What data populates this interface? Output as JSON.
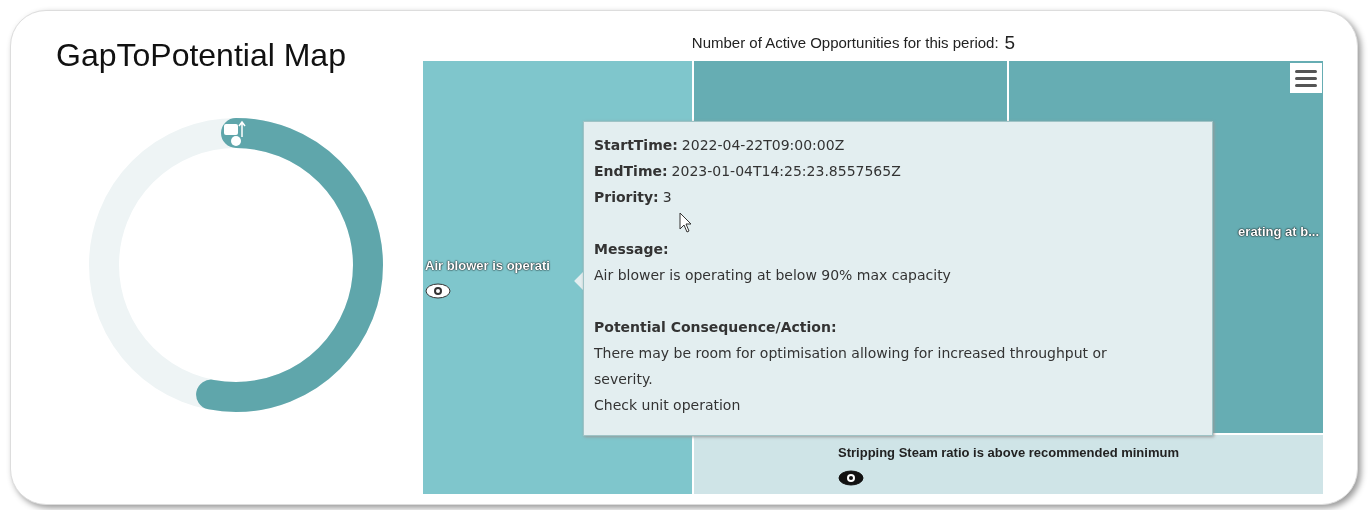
{
  "title": "GapToPotential Map",
  "gauge": {
    "level": 0.53
  },
  "opportunities": {
    "label": "Number of Active Opportunities for this period:",
    "count": "5"
  },
  "treemap": {
    "cells": [
      {
        "label": "Air blower is operati",
        "color": "#7fc6cc"
      },
      {
        "color": "#66adb3"
      },
      {
        "label": "erating at b...",
        "color": "#66adb3"
      },
      {
        "label": "Stripping Steam ratio is above recommended minimum",
        "color": "#cfe4e7"
      }
    ]
  },
  "tooltip": {
    "fields": [
      {
        "label": "StartTime:",
        "value": "2022-04-22T09:00:00Z"
      },
      {
        "label": "EndTime:",
        "value": "2023-01-04T14:25:23.8557565Z"
      },
      {
        "label": "Priority:",
        "value": "3"
      }
    ],
    "sections": [
      {
        "heading": "Message:",
        "lines": [
          "Air blower is operating at below 90% max capacity"
        ]
      },
      {
        "heading": "Potential Consequence/Action:",
        "lines": [
          "There may be room for optimisation allowing for increased throughput or severity.",
          "Check unit operation"
        ]
      }
    ]
  }
}
